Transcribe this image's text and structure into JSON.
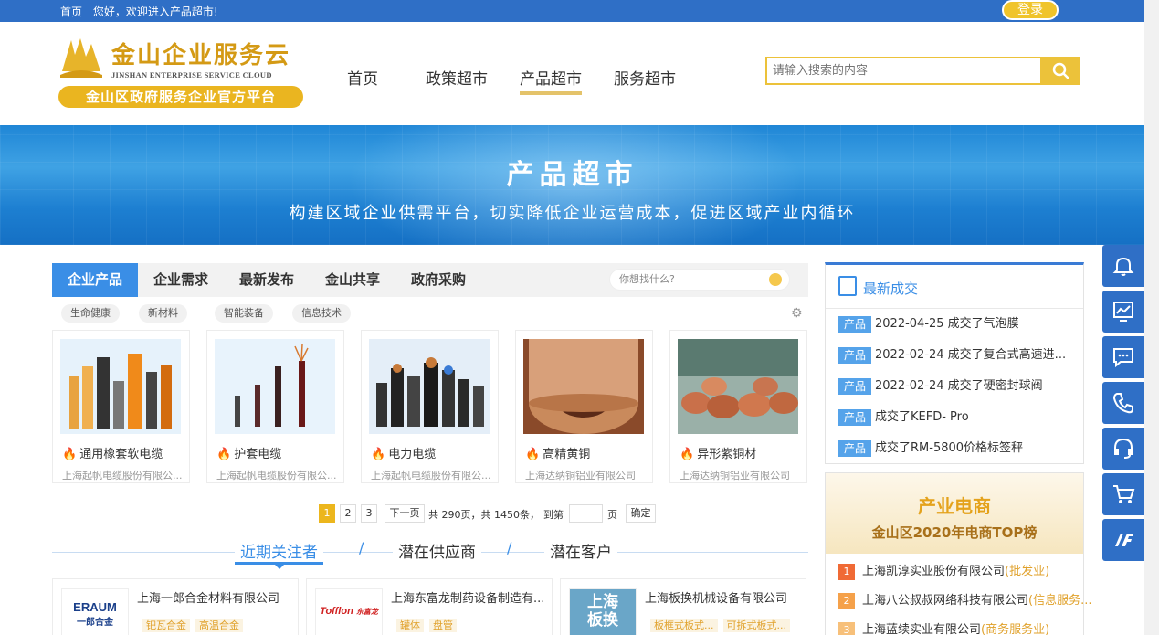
{
  "topbar": {
    "home_link": "首页",
    "welcome": "您好，欢迎进入产品超市!",
    "login_label": "登录"
  },
  "logo": {
    "title": "金山企业服务云",
    "english": "JINSHAN ENTERPRISE SERVICE CLOUD",
    "subtitle": "金山区政府服务企业官方平台"
  },
  "nav": {
    "items": [
      {
        "label": "首页"
      },
      {
        "label": "政策超市"
      },
      {
        "label": "产品超市",
        "active": true
      },
      {
        "label": "服务超市"
      }
    ]
  },
  "search": {
    "placeholder": "请输入搜索的内容"
  },
  "banner": {
    "title": "产品超市",
    "subtitle": "构建区域企业供需平台，切实降低企业运营成本，促进区域产业内循环"
  },
  "product_tabs": {
    "items": [
      "企业产品",
      "企业需求",
      "最新发布",
      "金山共享",
      "政府采购"
    ],
    "active_index": 0,
    "find_placeholder": "你想找什么?"
  },
  "categories": [
    "生命健康",
    "新材料",
    "智能装备",
    "信息技术"
  ],
  "products": [
    {
      "name": "通用橡套软电缆",
      "company": "上海起帆电缆股份有限公..."
    },
    {
      "name": "护套电缆",
      "company": "上海起帆电缆股份有限公..."
    },
    {
      "name": "电力电缆",
      "company": "上海起帆电缆股份有限公..."
    },
    {
      "name": "高精黄铜",
      "company": "上海达纳铜铝业有限公司"
    },
    {
      "name": "异形紫铜材",
      "company": "上海达纳铜铝业有限公司"
    }
  ],
  "pager": {
    "pages": [
      "1",
      "2",
      "3"
    ],
    "current": "1",
    "next_label": "下一页",
    "summary": "共 290页，共 1450条，",
    "goto_label": "到第",
    "page_suffix": "页",
    "confirm_label": "确定"
  },
  "supplier_tabs": {
    "items": [
      "近期关注者",
      "潜在供应商",
      "潜在客户"
    ],
    "separator": "/"
  },
  "suppliers": [
    {
      "name": "上海一郎合金材料有限公司",
      "logo_text_1": "ERAUM",
      "logo_text_2": "一郎合金",
      "tags": [
        "钯瓦合金",
        "高温合金"
      ]
    },
    {
      "name": "上海东富龙制药设备制造有...",
      "logo_text_1": "Tofflon",
      "logo_text_2": "东富龙",
      "tags": [
        "罐体",
        "盘管"
      ]
    },
    {
      "name": "上海板换机械设备有限公司",
      "logo_text_1": "上海",
      "logo_text_2": "板换",
      "tags": [
        "板框式板式...",
        "可拆式板式..."
      ]
    }
  ],
  "deals": {
    "title": "最新成交",
    "badge": "产品",
    "items": [
      "2022-04-25 成交了气泡膜",
      "2022-02-24 成交了复合式高速进...",
      "2022-02-24 成交了硬密封球阀",
      " 成交了KEFD- Pro",
      " 成交了RM-5800价格标签秤"
    ]
  },
  "ecommerce": {
    "title": "产业电商",
    "subtitle": "金山区2020年电商TOP榜",
    "ranks": [
      {
        "num": "1",
        "name": "上海凯淳实业股份有限公司",
        "cat": "(批发业)",
        "color": "#f06a35"
      },
      {
        "num": "2",
        "name": "上海八公叔叔网络科技有限公司",
        "cat": "(信息服务...",
        "color": "#f5a14a"
      },
      {
        "num": "3",
        "name": "上海蓝续实业有限公司",
        "cat": "(商务服务业)",
        "color": "#f7c07a"
      }
    ]
  },
  "float_icons": [
    "bell-icon",
    "chart-icon",
    "chat-icon",
    "phone-icon",
    "headset-icon",
    "cart-icon",
    "logo-icon"
  ],
  "colors": {
    "primary": "#2f6fc6",
    "accent": "#ecc23a",
    "tab_active": "#3a8ee6"
  }
}
